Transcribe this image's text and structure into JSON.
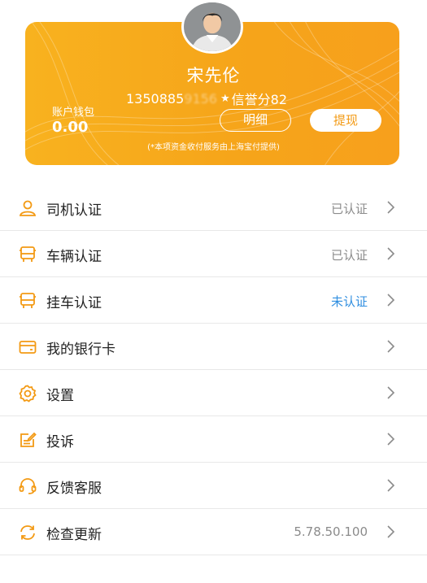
{
  "header": {
    "user_name": "宋先伦",
    "phone_visible": "1350885",
    "phone_masked": "9156",
    "credit": "信誉分82",
    "wallet_label": "账户钱包",
    "wallet_value": "0.00",
    "detail_label": "明细",
    "withdraw_label": "提现",
    "note": "(*本项资金收付服务由上海宝付提供)"
  },
  "list": [
    {
      "label": "司机认证",
      "status": "已认证",
      "icon": "driver-icon"
    },
    {
      "label": "车辆认证",
      "status": "已认证",
      "icon": "truck-icon"
    },
    {
      "label": "挂车认证",
      "status": "未认证",
      "icon": "trailer-icon"
    },
    {
      "label": "我的银行卡",
      "status": "",
      "icon": "bank-card-icon"
    },
    {
      "label": "设置",
      "status": "",
      "icon": "gear-icon"
    },
    {
      "label": "投诉",
      "status": "",
      "icon": "complaint-icon"
    },
    {
      "label": "反馈客服",
      "status": "",
      "icon": "headset-icon"
    },
    {
      "label": "检查更新",
      "status": "5.78.50.100",
      "icon": "refresh-icon"
    }
  ],
  "colors": {
    "accent": "#f39a14",
    "unverified": "#2f8ee0"
  }
}
